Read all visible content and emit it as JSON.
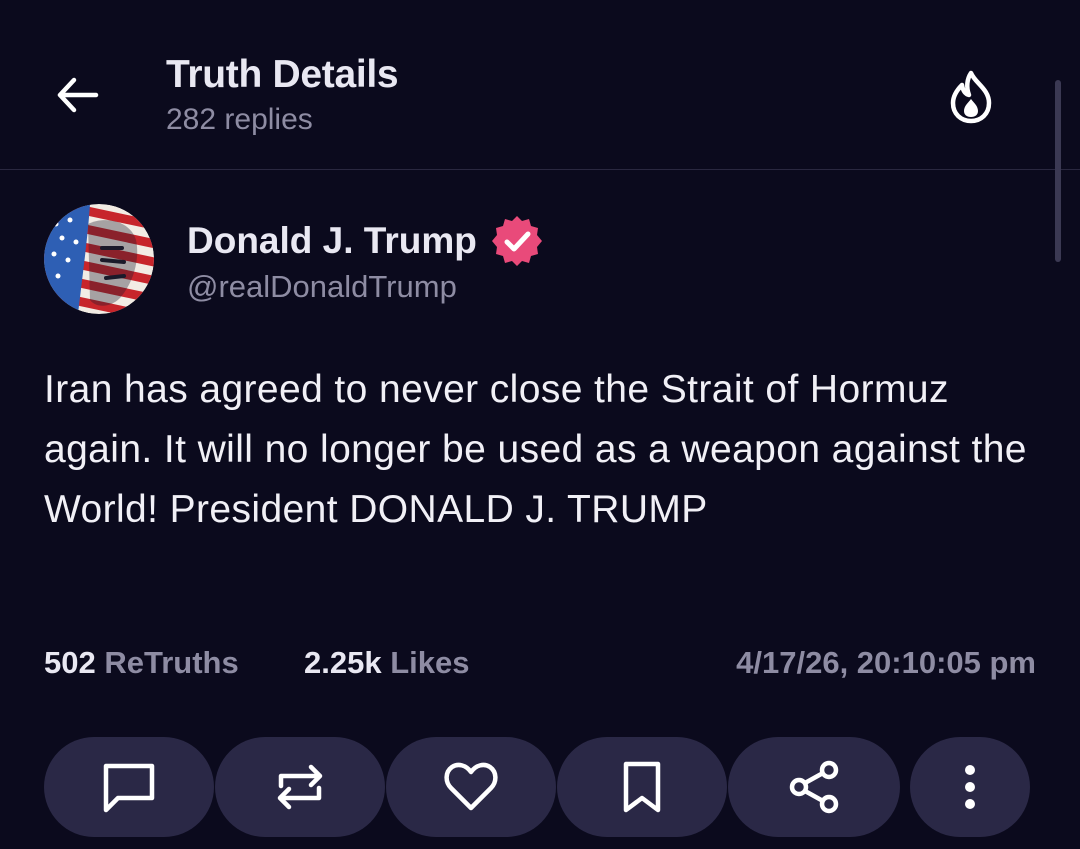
{
  "header": {
    "title": "Truth Details",
    "subtitle": "282 replies",
    "back_icon": "arrow-left-icon",
    "trending_icon": "flame-icon"
  },
  "post": {
    "author": {
      "name": "Donald J. Trump",
      "handle": "@realDonaldTrump",
      "verified": true,
      "verified_color": "#e94a7a"
    },
    "text": "Iran has agreed to never close the Strait of Hormuz again. It will no longer be used as a weapon against the World! President DONALD J. TRUMP",
    "stats": {
      "retruths_count": "502",
      "retruths_label": "ReTruths",
      "likes_count": "2.25k",
      "likes_label": "Likes",
      "timestamp": "4/17/26, 20:10:05 pm"
    }
  },
  "actions": [
    {
      "name": "reply",
      "icon": "comment-icon"
    },
    {
      "name": "retruth",
      "icon": "repost-icon"
    },
    {
      "name": "like",
      "icon": "heart-icon"
    },
    {
      "name": "bookmark",
      "icon": "bookmark-icon"
    },
    {
      "name": "share",
      "icon": "share-icon"
    },
    {
      "name": "more",
      "icon": "more-vertical-icon"
    }
  ],
  "colors": {
    "background": "#0b0a1d",
    "action_button": "#2a2846",
    "muted_text": "#8e8ca3"
  }
}
